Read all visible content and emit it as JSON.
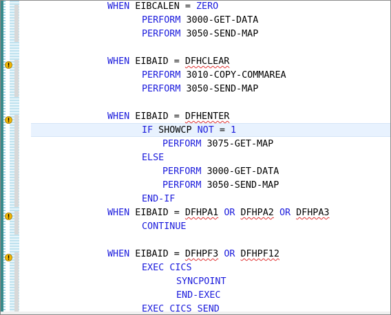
{
  "editor": {
    "lines": [
      {
        "i": 13,
        "toks": [
          [
            "WHEN",
            "kw"
          ],
          [
            " EIBCALEN = "
          ],
          [
            "ZERO",
            "kw"
          ]
        ]
      },
      {
        "i": 18,
        "toks": [
          [
            "PERFORM",
            "kw"
          ],
          [
            " 3000-GET-DATA"
          ]
        ]
      },
      {
        "i": 18,
        "toks": [
          [
            "PERFORM",
            "kw"
          ],
          [
            " 3050-SEND-MAP"
          ]
        ]
      },
      {
        "i": 0,
        "toks": []
      },
      {
        "i": 13,
        "toks": [
          [
            "WHEN",
            "kw"
          ],
          [
            " EIBAID = "
          ],
          [
            "DFHCLEAR",
            "sq"
          ]
        ]
      },
      {
        "i": 18,
        "toks": [
          [
            "PERFORM",
            "kw"
          ],
          [
            " 3010-COPY-COMMAREA"
          ]
        ]
      },
      {
        "i": 18,
        "toks": [
          [
            "PERFORM",
            "kw"
          ],
          [
            " 3050-SEND-MAP"
          ]
        ]
      },
      {
        "i": 0,
        "toks": []
      },
      {
        "i": 13,
        "toks": [
          [
            "WHEN",
            "kw"
          ],
          [
            " EIBAID = "
          ],
          [
            "DFHENTER",
            "sq"
          ]
        ]
      },
      {
        "i": 18,
        "toks": [
          [
            "IF",
            "kw"
          ],
          [
            " SHOWCP "
          ],
          [
            "NOT",
            "kw"
          ],
          [
            " = "
          ],
          [
            "1",
            "kw"
          ]
        ]
      },
      {
        "i": 21,
        "toks": [
          [
            "PERFORM",
            "kw"
          ],
          [
            " 3075-GET-MAP"
          ]
        ]
      },
      {
        "i": 18,
        "toks": [
          [
            "ELSE",
            "kw"
          ]
        ]
      },
      {
        "i": 21,
        "toks": [
          [
            "PERFORM",
            "kw"
          ],
          [
            " 3000-GET-DATA"
          ]
        ]
      },
      {
        "i": 21,
        "toks": [
          [
            "PERFORM",
            "kw"
          ],
          [
            " 3050-SEND-MAP"
          ]
        ]
      },
      {
        "i": 18,
        "toks": [
          [
            "END-IF",
            "kw"
          ]
        ]
      },
      {
        "i": 13,
        "toks": [
          [
            "WHEN",
            "kw"
          ],
          [
            " EIBAID = "
          ],
          [
            "DFHPA1",
            "sq"
          ],
          [
            " "
          ],
          [
            "OR",
            "kw"
          ],
          [
            " "
          ],
          [
            "DFHPA2",
            "sq"
          ],
          [
            " "
          ],
          [
            "OR",
            "kw"
          ],
          [
            " "
          ],
          [
            "DFHPA3",
            "sq"
          ]
        ]
      },
      {
        "i": 18,
        "toks": [
          [
            "CONTINUE",
            "kw"
          ]
        ]
      },
      {
        "i": 0,
        "toks": []
      },
      {
        "i": 13,
        "toks": [
          [
            "WHEN",
            "kw"
          ],
          [
            " EIBAID = "
          ],
          [
            "DFHPF3",
            "sq"
          ],
          [
            " "
          ],
          [
            "OR",
            "kw"
          ],
          [
            " "
          ],
          [
            "DFHPF12",
            "sq"
          ]
        ]
      },
      {
        "i": 18,
        "toks": [
          [
            "EXEC",
            "kw"
          ],
          [
            " "
          ],
          [
            "CICS",
            "kw"
          ]
        ]
      },
      {
        "i": 23,
        "toks": [
          [
            "SYNCPOINT",
            "kw"
          ]
        ]
      },
      {
        "i": 23,
        "toks": [
          [
            "END-EXEC",
            "kw"
          ]
        ]
      },
      {
        "i": 18,
        "toks": [
          [
            "EXEC",
            "kw"
          ],
          [
            " "
          ],
          [
            "CICS",
            "kw"
          ],
          [
            " "
          ],
          [
            "SEND",
            "kw"
          ]
        ]
      }
    ],
    "warning_lines": [
      4,
      8,
      15,
      18
    ],
    "colors": {
      "keyword": "#1a1adc",
      "text": "#000000",
      "current_line": "#e8f2fe",
      "warning": "#f2b705"
    }
  }
}
